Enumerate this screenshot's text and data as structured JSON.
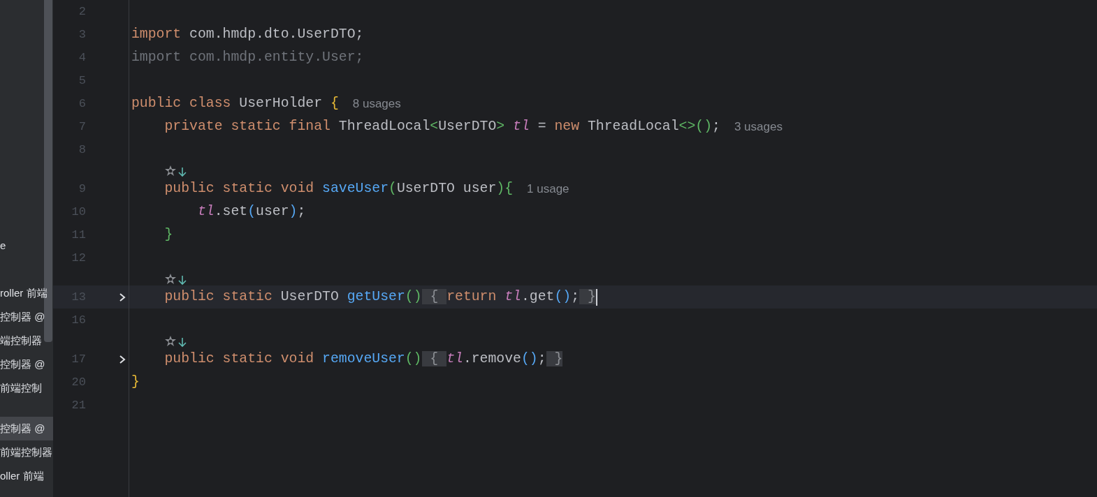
{
  "sidebar": {
    "items": [
      {
        "label": "e",
        "selected": false
      },
      {
        "label": "roller 前端",
        "selected": false
      },
      {
        "label": "控制器 @",
        "selected": false
      },
      {
        "label": "端控制器",
        "selected": false
      },
      {
        "label": "控制器 @",
        "selected": false
      },
      {
        "label": "前端控制",
        "selected": false
      },
      {
        "label": "控制器 @",
        "selected": true
      },
      {
        "label": "前端控制器",
        "selected": false
      },
      {
        "label": "oller 前端",
        "selected": false
      }
    ]
  },
  "editor": {
    "lines": [
      {
        "kind": "code",
        "number": "2"
      },
      {
        "kind": "code",
        "number": "3",
        "tokens": [
          {
            "text": "import",
            "kind": "keyword"
          },
          {
            "text": " com.hmdp.dto.UserDTO;",
            "kind": "plain"
          }
        ]
      },
      {
        "kind": "code",
        "number": "4",
        "tokens": [
          {
            "text": "import com.hmdp.entity.User;",
            "kind": "unused"
          }
        ]
      },
      {
        "kind": "code",
        "number": "5"
      },
      {
        "kind": "code",
        "number": "6",
        "tokens": [
          {
            "text": "public class ",
            "kind": "keyword"
          },
          {
            "text": "UserHolder ",
            "kind": "plain"
          },
          {
            "text": "{",
            "kind": "yellow"
          }
        ],
        "hint": "8 usages"
      },
      {
        "kind": "code",
        "number": "7",
        "tokens": [
          {
            "text": "    private static final ",
            "kind": "keyword"
          },
          {
            "text": "ThreadLocal",
            "kind": "plain"
          },
          {
            "text": "<",
            "kind": "green"
          },
          {
            "text": "UserDTO",
            "kind": "plain"
          },
          {
            "text": ">",
            "kind": "green"
          },
          {
            "text": " tl",
            "kind": "field"
          },
          {
            "text": " = ",
            "kind": "plain"
          },
          {
            "text": "new ",
            "kind": "keyword"
          },
          {
            "text": "ThreadLocal",
            "kind": "plain"
          },
          {
            "text": "<>()",
            "kind": "green"
          },
          {
            "text": ";",
            "kind": "plain"
          }
        ],
        "hint": "3 usages"
      },
      {
        "kind": "code",
        "number": "8"
      },
      {
        "kind": "annotation"
      },
      {
        "kind": "code",
        "number": "9",
        "tokens": [
          {
            "text": "    public static void ",
            "kind": "keyword"
          },
          {
            "text": "saveUser",
            "kind": "method"
          },
          {
            "text": "(",
            "kind": "green"
          },
          {
            "text": "UserDTO user",
            "kind": "plain"
          },
          {
            "text": "){",
            "kind": "green"
          }
        ],
        "hint": "1 usage"
      },
      {
        "kind": "code",
        "number": "10",
        "tokens": [
          {
            "text": "        tl",
            "kind": "field"
          },
          {
            "text": ".set",
            "kind": "plain"
          },
          {
            "text": "(",
            "kind": "blue"
          },
          {
            "text": "user",
            "kind": "plain"
          },
          {
            "text": ")",
            "kind": "blue"
          },
          {
            "text": ";",
            "kind": "plain"
          }
        ]
      },
      {
        "kind": "code",
        "number": "11",
        "tokens": [
          {
            "text": "    }",
            "kind": "green"
          }
        ]
      },
      {
        "kind": "code",
        "number": "12"
      },
      {
        "kind": "annotation"
      },
      {
        "kind": "code",
        "number": "13",
        "current": true,
        "folded": true,
        "tokens": [
          {
            "text": "    public static ",
            "kind": "keyword"
          },
          {
            "text": "UserDTO ",
            "kind": "plain"
          },
          {
            "text": "getUser",
            "kind": "method"
          },
          {
            "text": "()",
            "kind": "green"
          },
          {
            "text": " { ",
            "kind": "fold"
          },
          {
            "text": "return ",
            "kind": "keyword"
          },
          {
            "text": "tl",
            "kind": "field"
          },
          {
            "text": ".get",
            "kind": "plain"
          },
          {
            "text": "()",
            "kind": "blue"
          },
          {
            "text": ";",
            "kind": "plain"
          },
          {
            "text": " }",
            "kind": "fold"
          }
        ]
      },
      {
        "kind": "code",
        "number": "16"
      },
      {
        "kind": "annotation"
      },
      {
        "kind": "code",
        "number": "17",
        "folded": true,
        "tokens": [
          {
            "text": "    public static void ",
            "kind": "keyword"
          },
          {
            "text": "removeUser",
            "kind": "method"
          },
          {
            "text": "()",
            "kind": "green"
          },
          {
            "text": " { ",
            "kind": "fold"
          },
          {
            "text": "tl",
            "kind": "field"
          },
          {
            "text": ".remove",
            "kind": "plain"
          },
          {
            "text": "()",
            "kind": "blue"
          },
          {
            "text": ";",
            "kind": "plain"
          },
          {
            "text": " }",
            "kind": "fold"
          }
        ]
      },
      {
        "kind": "code",
        "number": "20",
        "tokens": [
          {
            "text": "}",
            "kind": "yellow"
          }
        ]
      },
      {
        "kind": "code",
        "number": "21"
      }
    ]
  }
}
